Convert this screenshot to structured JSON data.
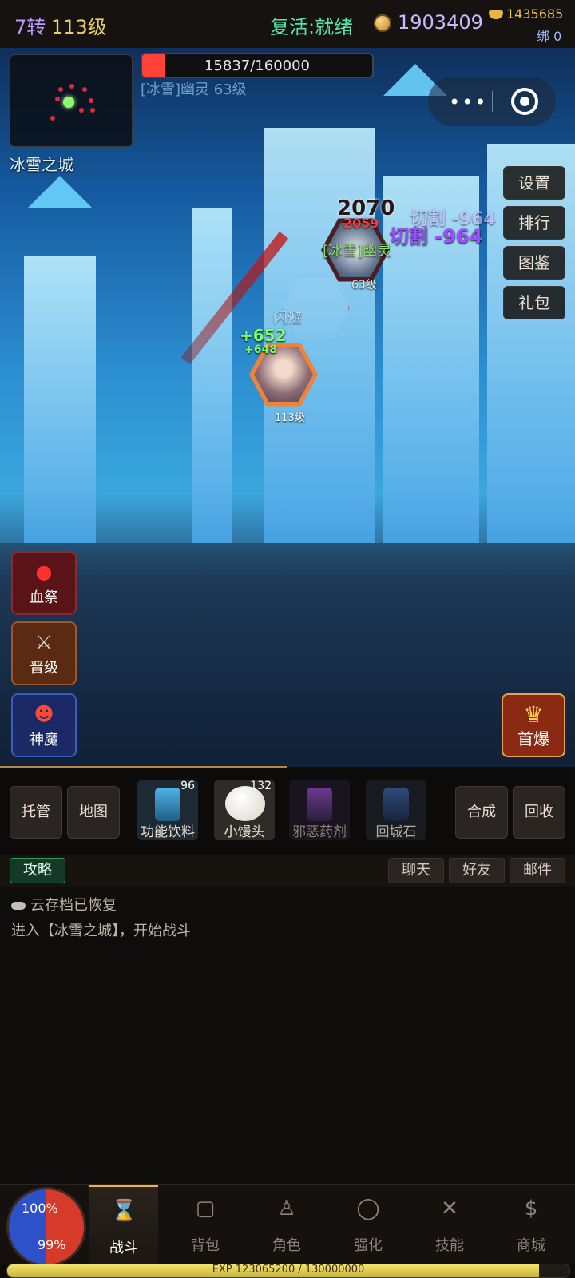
{
  "top": {
    "reborn": "7转",
    "level": "113级",
    "revive": "复活:就绪",
    "coins": "1903409",
    "gold": "1435685",
    "bind": "绑 0"
  },
  "map": {
    "name": "冰雪之城"
  },
  "target": {
    "hp_text": "15837/160000",
    "hp_fraction": 0.099,
    "name": "[冰雪]幽灵 63级"
  },
  "right_menu": [
    "设置",
    "排行",
    "图鉴",
    "礼包"
  ],
  "battle": {
    "dmg_big": "2070",
    "dmg_small": "2059",
    "cut": "切割 -964",
    "enemy_label": "[冰雪]幽灵",
    "enemy_level": "63级",
    "dodge": "闪避",
    "heal_big": "+652",
    "heal_small": "+648",
    "player_level": "113级"
  },
  "left_buttons": {
    "blood": "血祭",
    "upgrade": "晋级",
    "demon": "神魔"
  },
  "first_kill": "首爆",
  "toolbar": {
    "auto": "托管",
    "map": "地图",
    "synth": "合成",
    "recycle": "回收",
    "items": [
      {
        "name": "功能饮料",
        "count": "96"
      },
      {
        "name": "小馒头",
        "count": "132"
      },
      {
        "name": "邪恶药剂",
        "count": ""
      },
      {
        "name": "回城石",
        "count": ""
      }
    ]
  },
  "social": {
    "guide": "攻略",
    "chat": "聊天",
    "friends": "好友",
    "mail": "邮件"
  },
  "log": [
    "云存档已恢复",
    "进入【冰雪之城】，开始战斗"
  ],
  "orb": {
    "hp": "100%",
    "mp": "99%"
  },
  "nav": [
    "战斗",
    "背包",
    "角色",
    "强化",
    "技能",
    "商城"
  ],
  "exp": {
    "text": "EXP 123065200 / 130000000",
    "fraction": 0.9467
  },
  "colors": {
    "accent": "#e8b640",
    "hp_red": "#ff4338",
    "exp_yellow": "#f2e36a"
  }
}
